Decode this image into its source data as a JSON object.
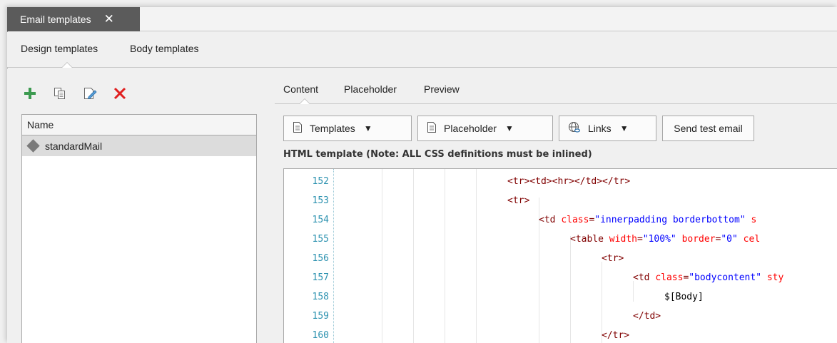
{
  "window": {
    "doc_tab_label": "Email templates",
    "doc_tab_close": "✕"
  },
  "subnav": {
    "items": [
      "Design templates",
      "Body templates"
    ],
    "active_index": 0
  },
  "left_toolbar": {
    "icons": [
      "add-icon",
      "copy-icon",
      "edit-icon",
      "delete-icon"
    ]
  },
  "name_list": {
    "header": "Name",
    "rows": [
      {
        "label": "standardMail",
        "selected": true
      }
    ]
  },
  "content_tabs": {
    "items": [
      "Content",
      "Placeholder",
      "Preview"
    ],
    "active_index": 0
  },
  "toolbar": {
    "templates_label": "Templates",
    "placeholder_label": "Placeholder",
    "links_label": "Links",
    "send_test_label": "Send test email"
  },
  "editor": {
    "label": "HTML template (Note: ALL CSS definitions must be inlined)",
    "line_numbers": [
      "152",
      "153",
      "154",
      "155",
      "156",
      "157",
      "158",
      "159",
      "160"
    ],
    "lines": [
      "<tr><td><hr></td></tr>",
      "<tr>",
      "<td class=\"innerpadding borderbottom\" s",
      "<table width=\"100%\" border=\"0\" cel",
      "<tr>",
      "<td class=\"bodycontent\" sty",
      "$[Body]",
      "</td>",
      "</tr>"
    ]
  },
  "colors": {
    "doc_tab_bg": "#5b5b5b",
    "add_icon": "#3c9a50",
    "delete_icon": "#e02020",
    "line_number": "#2b91af",
    "tag": "#800000",
    "attribute": "#ff0000",
    "attribute_value": "#0000ff"
  }
}
